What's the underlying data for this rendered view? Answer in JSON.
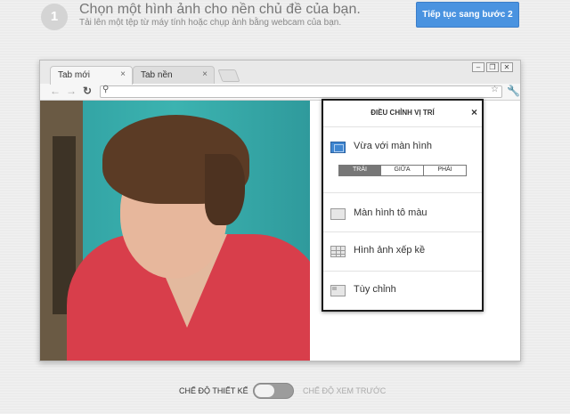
{
  "step": {
    "number": "1",
    "title": "Chọn một hình ảnh cho nền chủ đề của bạn.",
    "subtitle": "Tải lên một tệp từ máy tính hoặc chụp ảnh bằng webcam của bạn.",
    "next_button": "Tiếp tục sang bước 2"
  },
  "browser": {
    "tabs": [
      {
        "label": "Tab mới",
        "active": true
      },
      {
        "label": "Tab nền",
        "active": false
      }
    ],
    "close_glyph": "×",
    "window_controls": [
      "–",
      "❐",
      "✕"
    ],
    "address_value": ""
  },
  "panel": {
    "title": "ĐIỀU CHỈNH VỊ TRÍ",
    "close_glyph": "×",
    "options": [
      {
        "label": "Vừa với màn hình",
        "icon": "fit-screen-icon",
        "selected": true
      },
      {
        "label": "Màn hình tô màu",
        "icon": "fill-screen-icon",
        "selected": false
      },
      {
        "label": "Hình ảnh xếp kề",
        "icon": "tile-icon",
        "selected": false
      },
      {
        "label": "Tùy chỉnh",
        "icon": "custom-icon",
        "selected": false
      }
    ],
    "alignment": {
      "options": [
        "TRÁI",
        "GIỮA",
        "PHẢI"
      ],
      "selected": "TRÁI"
    }
  },
  "mode_toggle": {
    "left_label": "CHẾ ĐỘ THIẾT KẾ",
    "right_label": "CHẾ ĐỘ XEM TRƯỚC",
    "value": "design"
  },
  "colors": {
    "accent": "#4a93e0",
    "selected_icon": "#3f86d0"
  }
}
